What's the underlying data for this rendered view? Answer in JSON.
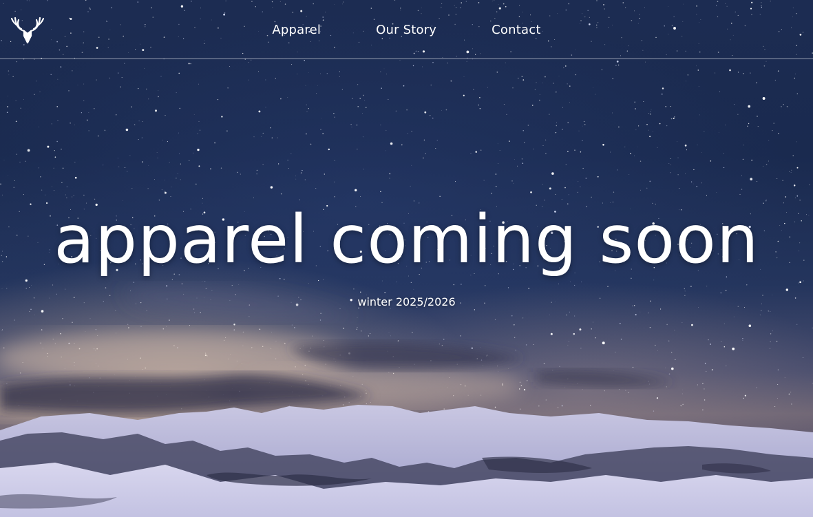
{
  "nav": {
    "logo_icon": "deer-antlers-icon",
    "links": [
      {
        "label": "Apparel"
      },
      {
        "label": "Our Story"
      },
      {
        "label": "Contact"
      }
    ]
  },
  "hero": {
    "title": "apparel coming soon",
    "subtitle": "winter 2025/2026",
    "background": "starry-night-sky-over-snowy-mountains"
  },
  "colors": {
    "text": "#ffffff",
    "sky_dark": "#1a2a4f",
    "horizon_glow": "#cdb4a0",
    "snow": "#dcdaf0"
  }
}
